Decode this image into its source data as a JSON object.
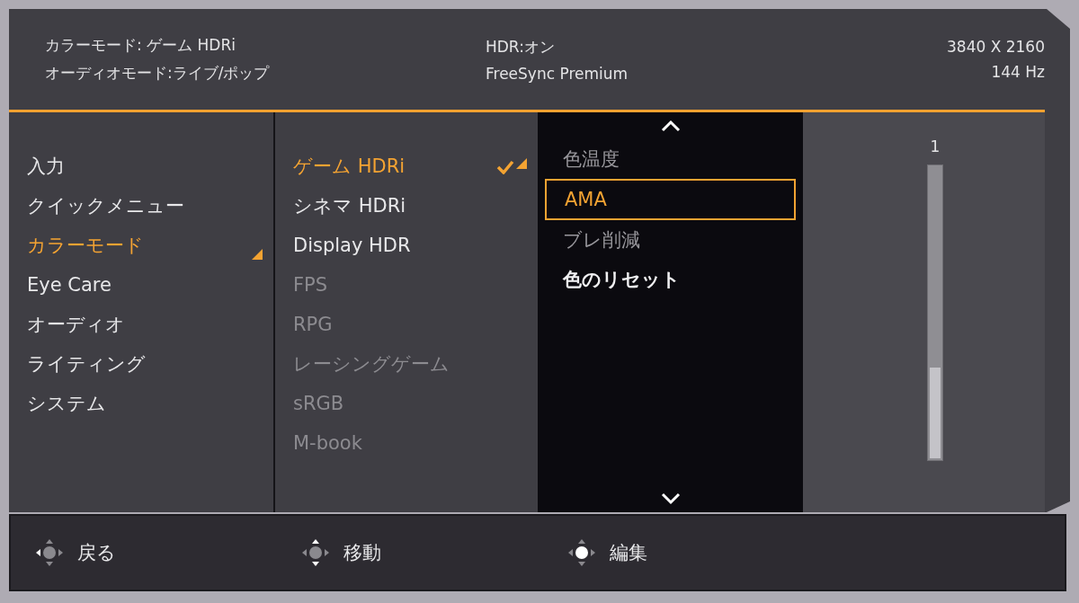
{
  "status": {
    "left": [
      "カラーモード: ゲーム HDRi",
      "オーディオモード:ライブ/ポップ"
    ],
    "center": [
      "HDR:オン",
      "FreeSync Premium"
    ],
    "right": [
      "3840 X 2160",
      "144 Hz"
    ]
  },
  "main_menu": [
    {
      "label": "入力",
      "selected": false
    },
    {
      "label": "クイックメニュー",
      "selected": false
    },
    {
      "label": "カラーモード",
      "selected": true
    },
    {
      "label": "Eye Care",
      "selected": false
    },
    {
      "label": "オーディオ",
      "selected": false
    },
    {
      "label": "ライティング",
      "selected": false
    },
    {
      "label": "システム",
      "selected": false
    }
  ],
  "color_modes": [
    {
      "label": "ゲーム HDRi",
      "selected": true,
      "checked": true,
      "disabled": false
    },
    {
      "label": "シネマ HDRi",
      "selected": false,
      "checked": false,
      "disabled": false
    },
    {
      "label": "Display HDR",
      "selected": false,
      "checked": false,
      "disabled": false
    },
    {
      "label": "FPS",
      "selected": false,
      "checked": false,
      "disabled": true
    },
    {
      "label": "RPG",
      "selected": false,
      "checked": false,
      "disabled": true
    },
    {
      "label": "レーシングゲーム",
      "selected": false,
      "checked": false,
      "disabled": true
    },
    {
      "label": "sRGB",
      "selected": false,
      "checked": false,
      "disabled": true
    },
    {
      "label": "M-book",
      "selected": false,
      "checked": false,
      "disabled": true
    }
  ],
  "settings": [
    {
      "label": "色温度",
      "selected": false,
      "disabled": true
    },
    {
      "label": "AMA",
      "selected": true,
      "disabled": false
    },
    {
      "label": "ブレ削減",
      "selected": false,
      "disabled": true
    },
    {
      "label": "色のリセット",
      "selected": false,
      "disabled": false
    }
  ],
  "value_slider": {
    "reading": "1",
    "level": 0.32
  },
  "footer": [
    {
      "kind": "left",
      "label": "戻る"
    },
    {
      "kind": "vertical",
      "label": "移動"
    },
    {
      "kind": "center",
      "label": "編集"
    }
  ]
}
